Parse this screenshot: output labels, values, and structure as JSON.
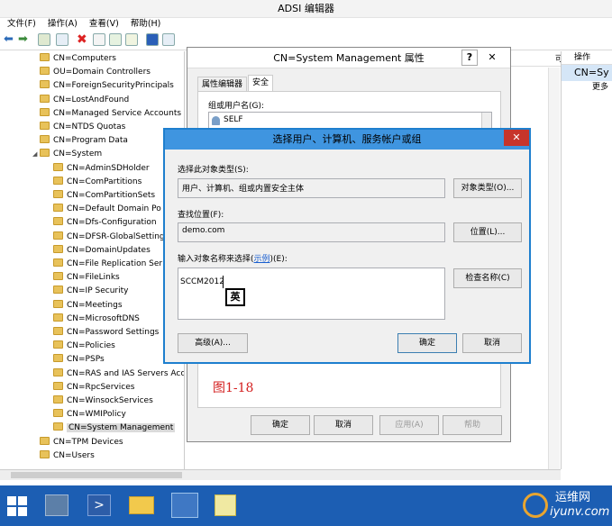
{
  "app": {
    "title": "ADSI 编辑器"
  },
  "menu": {
    "file": "文件(F)",
    "action": "操作(A)",
    "view": "查看(V)",
    "help": "帮助(H)"
  },
  "tree": {
    "items": [
      {
        "label": "CN=Computers",
        "indent": 1
      },
      {
        "label": "OU=Domain Controllers",
        "indent": 1
      },
      {
        "label": "CN=ForeignSecurityPrincipals",
        "indent": 1
      },
      {
        "label": "CN=LostAndFound",
        "indent": 1
      },
      {
        "label": "CN=Managed Service Accounts",
        "indent": 1
      },
      {
        "label": "CN=NTDS Quotas",
        "indent": 1
      },
      {
        "label": "CN=Program Data",
        "indent": 1
      },
      {
        "label": "CN=System",
        "indent": 1,
        "expanded": true
      },
      {
        "label": "CN=AdminSDHolder",
        "indent": 2
      },
      {
        "label": "CN=ComPartitions",
        "indent": 2
      },
      {
        "label": "CN=ComPartitionSets",
        "indent": 2
      },
      {
        "label": "CN=Default Domain Po",
        "indent": 2
      },
      {
        "label": "CN=Dfs-Configuration",
        "indent": 2
      },
      {
        "label": "CN=DFSR-GlobalSetting",
        "indent": 2
      },
      {
        "label": "CN=DomainUpdates",
        "indent": 2
      },
      {
        "label": "CN=File Replication Ser",
        "indent": 2
      },
      {
        "label": "CN=FileLinks",
        "indent": 2
      },
      {
        "label": "CN=IP Security",
        "indent": 2
      },
      {
        "label": "CN=Meetings",
        "indent": 2
      },
      {
        "label": "CN=MicrosoftDNS",
        "indent": 2
      },
      {
        "label": "CN=Password Settings",
        "indent": 2
      },
      {
        "label": "CN=Policies",
        "indent": 2
      },
      {
        "label": "CN=PSPs",
        "indent": 2
      },
      {
        "label": "CN=RAS and IAS Servers Acc",
        "indent": 2
      },
      {
        "label": "CN=RpcServices",
        "indent": 2
      },
      {
        "label": "CN=WinsockServices",
        "indent": 2
      },
      {
        "label": "CN=WMIPolicy",
        "indent": 2
      },
      {
        "label": "CN=System Management",
        "indent": 2,
        "selected": true
      },
      {
        "label": "CN=TPM Devices",
        "indent": 1
      },
      {
        "label": "CN=Users",
        "indent": 1
      }
    ]
  },
  "middle": {
    "col_header": "可"
  },
  "actions": {
    "header": "操作",
    "item": "CN=Sy",
    "more": "更多"
  },
  "props_dialog": {
    "title": "CN=System Management 属性",
    "help_btn": "?",
    "close_btn": "✕",
    "tab_attr": "属性编辑器",
    "tab_security": "安全",
    "group_label": "组或用户名(G):",
    "group_first": "SELF",
    "figure_label": "图1-18",
    "ok": "确定",
    "cancel": "取消",
    "apply": "应用(A)",
    "help": "帮助"
  },
  "select_dialog": {
    "title": "选择用户、计算机、服务帐户或组",
    "close": "✕",
    "type_label": "选择此对象类型(S):",
    "type_value": "用户、计算机、组或内置安全主体",
    "type_btn": "对象类型(O)...",
    "location_label": "查找位置(F):",
    "location_value": "demo.com",
    "location_btn": "位置(L)...",
    "names_label_pre": "输入对象名称来选择(",
    "names_label_link": "示例",
    "names_label_post": ")(E):",
    "names_value": "SCCM2012",
    "ime_indicator": "英",
    "check_btn": "检查名称(C)",
    "advanced_btn": "高级(A)...",
    "ok": "确定",
    "cancel": "取消"
  },
  "watermark": {
    "text": "运维网",
    "url": "iyunv.com"
  }
}
